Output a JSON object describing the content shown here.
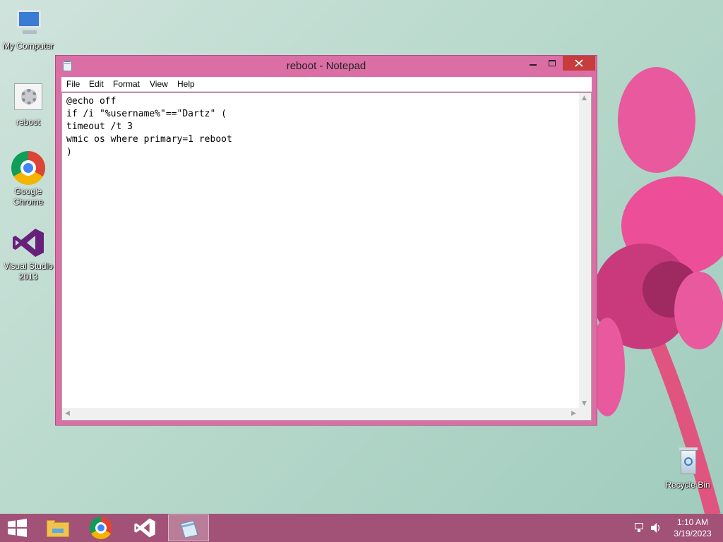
{
  "desktop": {
    "icons": [
      {
        "label": "My Computer",
        "icon": "computer-icon"
      },
      {
        "label": "reboot",
        "icon": "batch-file-icon"
      },
      {
        "label": "Google Chrome",
        "icon": "chrome-icon"
      },
      {
        "label": "Visual Studio 2013",
        "icon": "visual-studio-icon"
      },
      {
        "label": "Recycle Bin",
        "icon": "recycle-bin-icon"
      }
    ]
  },
  "window": {
    "title": "reboot - Notepad",
    "menu": [
      "File",
      "Edit",
      "Format",
      "View",
      "Help"
    ],
    "content": "@echo off\nif /i \"%username%\"==\"Dartz\" (\ntimeout /t 3\nwmic os where primary=1 reboot\n)"
  },
  "taskbar": {
    "apps": [
      "start-icon",
      "file-explorer-icon",
      "chrome-icon",
      "visual-studio-icon",
      "notepad-icon"
    ],
    "time": "1:10 AM",
    "date": "3/19/2023"
  },
  "colors": {
    "window_frame": "#db6fa5",
    "taskbar": "#a25277",
    "close_button": "#c73c3c"
  }
}
